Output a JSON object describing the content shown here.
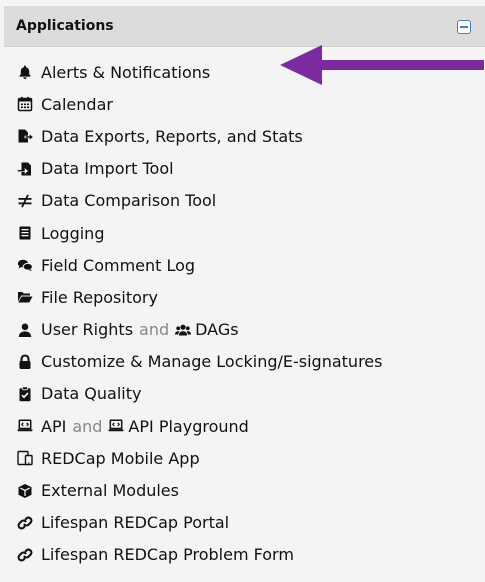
{
  "panel": {
    "title": "Applications"
  },
  "items": [
    {
      "label": "Alerts & Notifications"
    },
    {
      "label": "Calendar"
    },
    {
      "label": "Data Exports, Reports, and Stats"
    },
    {
      "label": "Data Import Tool"
    },
    {
      "label": "Data Comparison Tool"
    },
    {
      "label": "Logging"
    },
    {
      "label": "Field Comment Log"
    },
    {
      "label": "File Repository"
    },
    {
      "label": "User Rights",
      "joiner": "and",
      "label2": "DAGs"
    },
    {
      "label": "Customize & Manage Locking/E-signatures"
    },
    {
      "label": "Data Quality"
    },
    {
      "label": "API",
      "joiner": "and",
      "label2": "API Playground"
    },
    {
      "label": "REDCap Mobile App"
    },
    {
      "label": "External Modules"
    },
    {
      "label": "Lifespan REDCap Portal"
    },
    {
      "label": "Lifespan REDCap Problem Form"
    }
  ],
  "icons": {
    "alerts": "bell-icon",
    "calendar": "calendar-icon",
    "exports": "file-export-icon",
    "import": "file-import-icon",
    "compare": "not-equal-icon",
    "logging": "list-document-icon",
    "comments": "comments-icon",
    "repository": "folder-open-icon",
    "user_rights": "user-icon",
    "dags": "users-group-icon",
    "locking": "lock-icon",
    "quality": "clipboard-check-icon",
    "api": "laptop-code-icon",
    "mobile": "mobile-tablet-icon",
    "modules": "cube-icon",
    "links": "link-icon"
  },
  "colors": {
    "header_bg": "#dcdcdc",
    "panel_bg": "#f4f4f4",
    "annotation_arrow": "#7b2aa0"
  }
}
